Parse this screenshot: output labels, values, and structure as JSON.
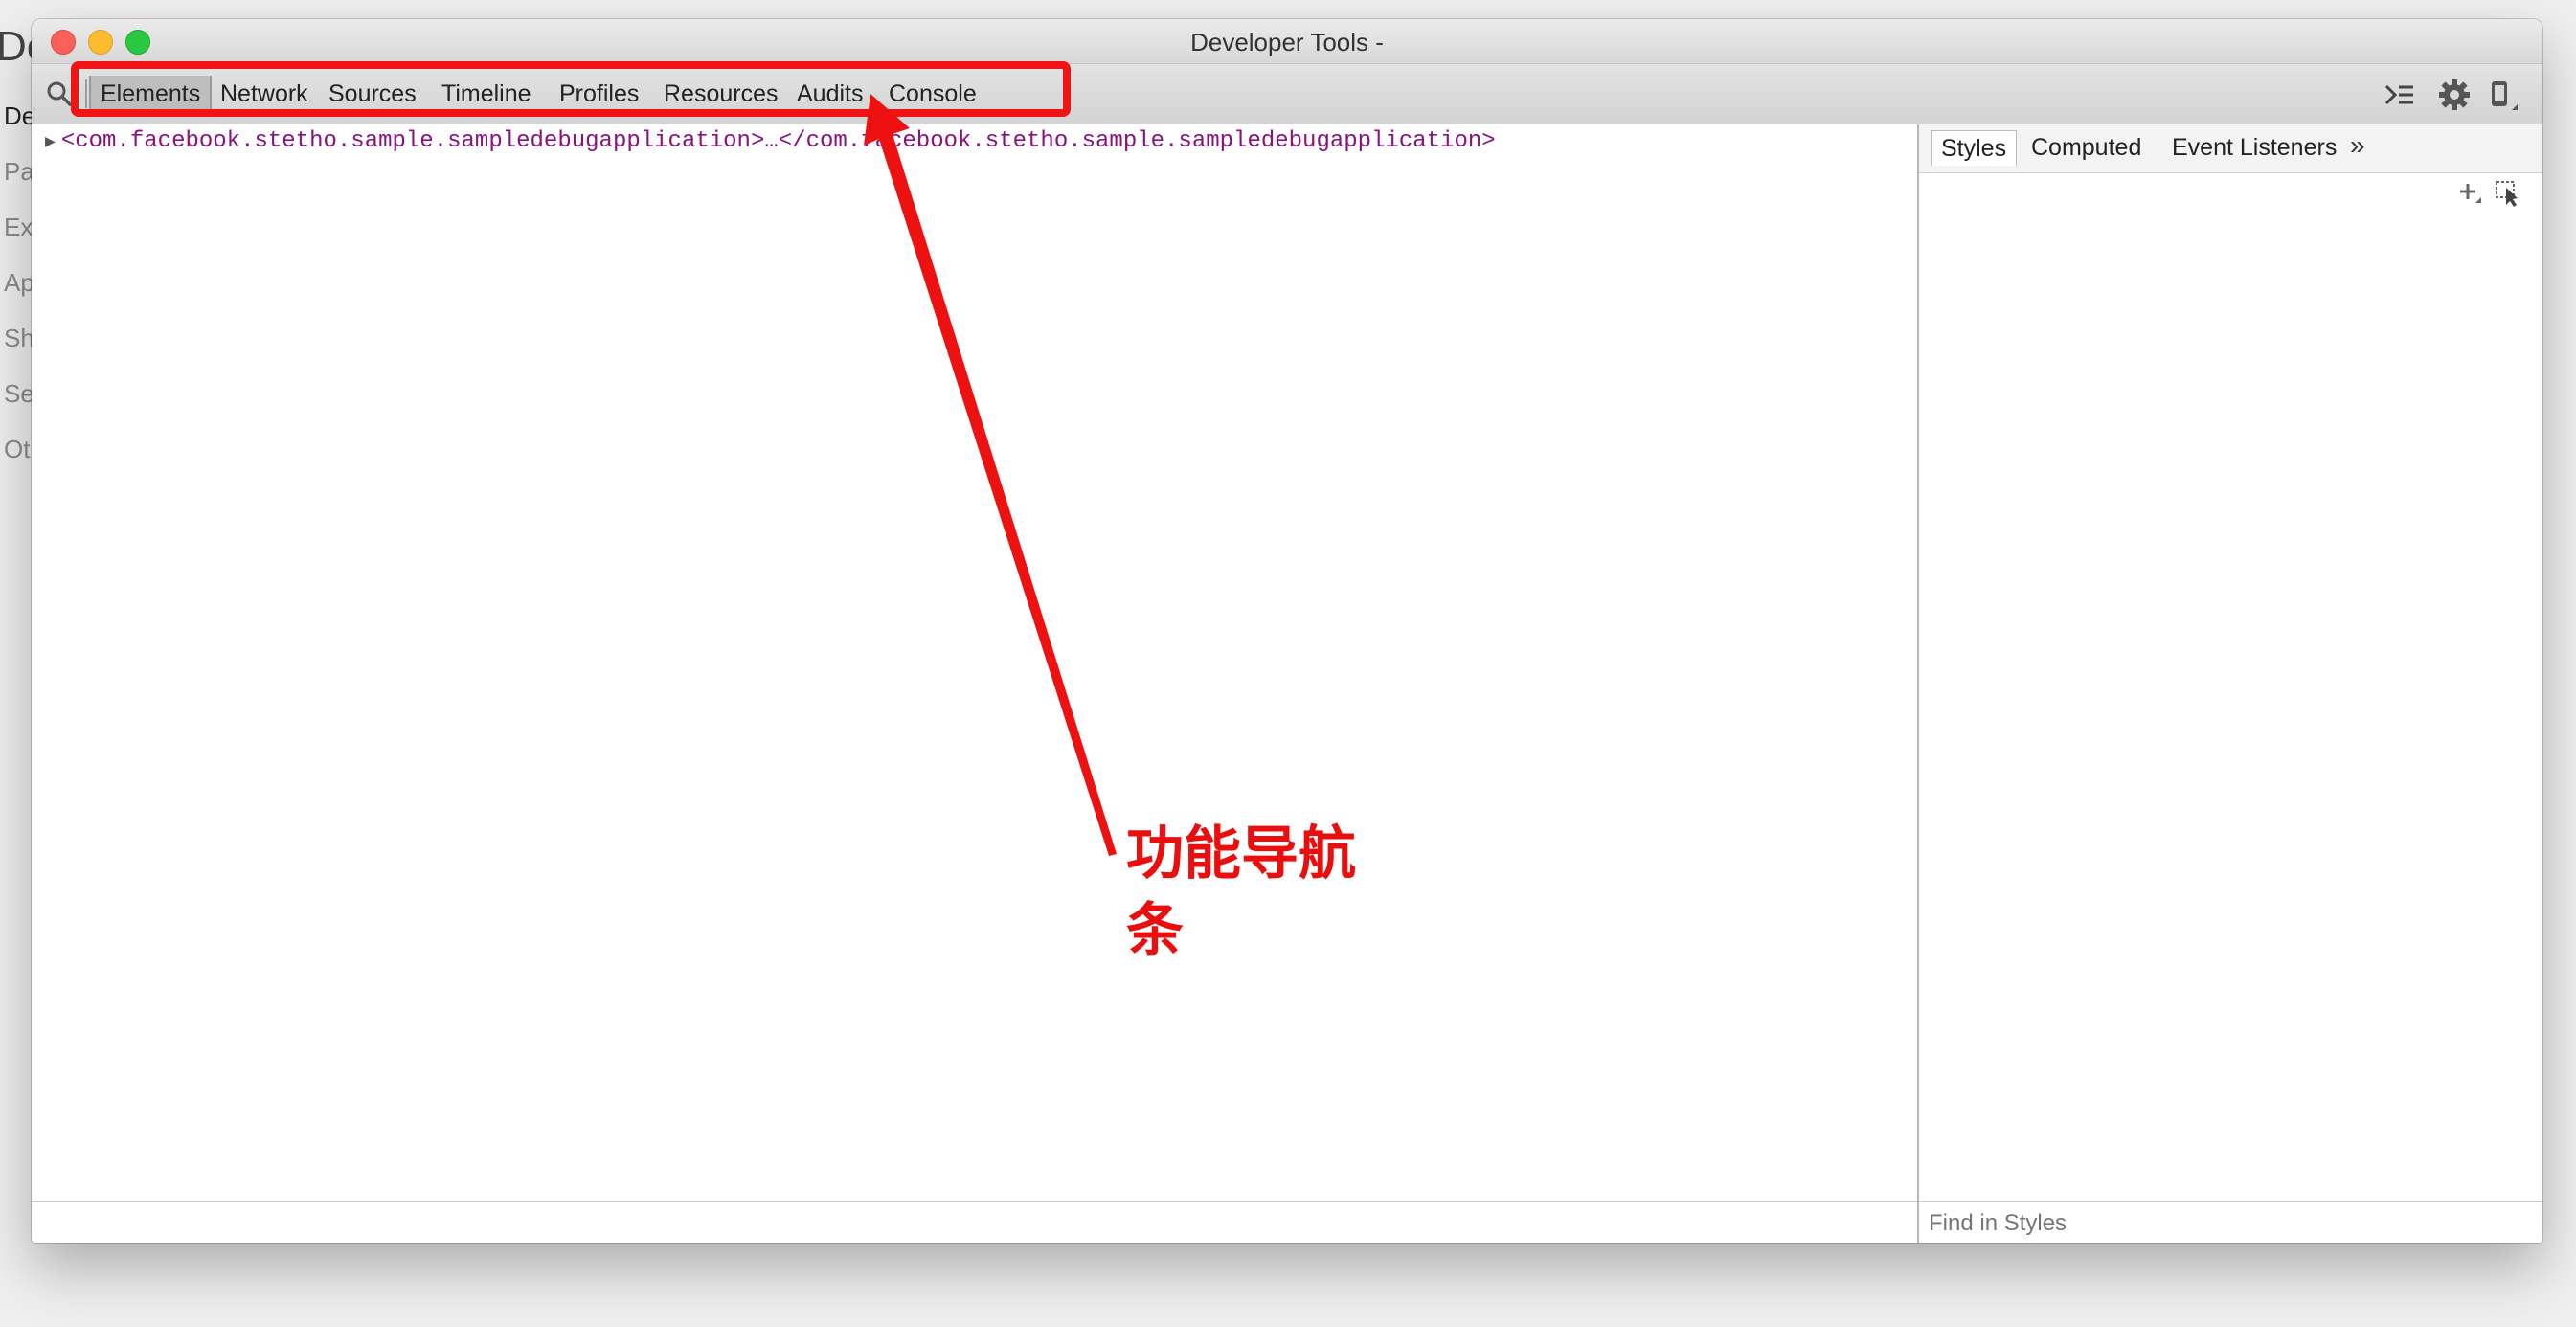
{
  "background_app": {
    "title_fragment": "De",
    "sidebar_items": [
      "De",
      "Pa",
      "Ex",
      "Ap",
      "Sh",
      "Se",
      "Ot"
    ]
  },
  "window": {
    "title": "Developer Tools -"
  },
  "toolbar": {
    "tabs": [
      {
        "label": "Elements",
        "active": true
      },
      {
        "label": "Network",
        "active": false
      },
      {
        "label": "Sources",
        "active": false
      },
      {
        "label": "Timeline",
        "active": false
      },
      {
        "label": "Profiles",
        "active": false
      },
      {
        "label": "Resources",
        "active": false
      },
      {
        "label": "Audits",
        "active": false
      },
      {
        "label": "Console",
        "active": false
      }
    ],
    "icons": [
      "search-icon",
      "console-drawer-icon",
      "gear-icon",
      "device-mode-icon"
    ]
  },
  "elements": {
    "dom_line": "<com.facebook.stetho.sample.sampledebugapplication>…</com.facebook.stetho.sample.sampledebugapplication>"
  },
  "sidebar": {
    "tabs": [
      {
        "label": "Styles",
        "active": true
      },
      {
        "label": "Computed",
        "active": false
      },
      {
        "label": "Event Listeners",
        "active": false
      }
    ],
    "more": "»",
    "find_placeholder": "Find in Styles"
  },
  "annotation": {
    "label_line1": "功能导航",
    "label_line2": "条",
    "color": "#f01414"
  }
}
